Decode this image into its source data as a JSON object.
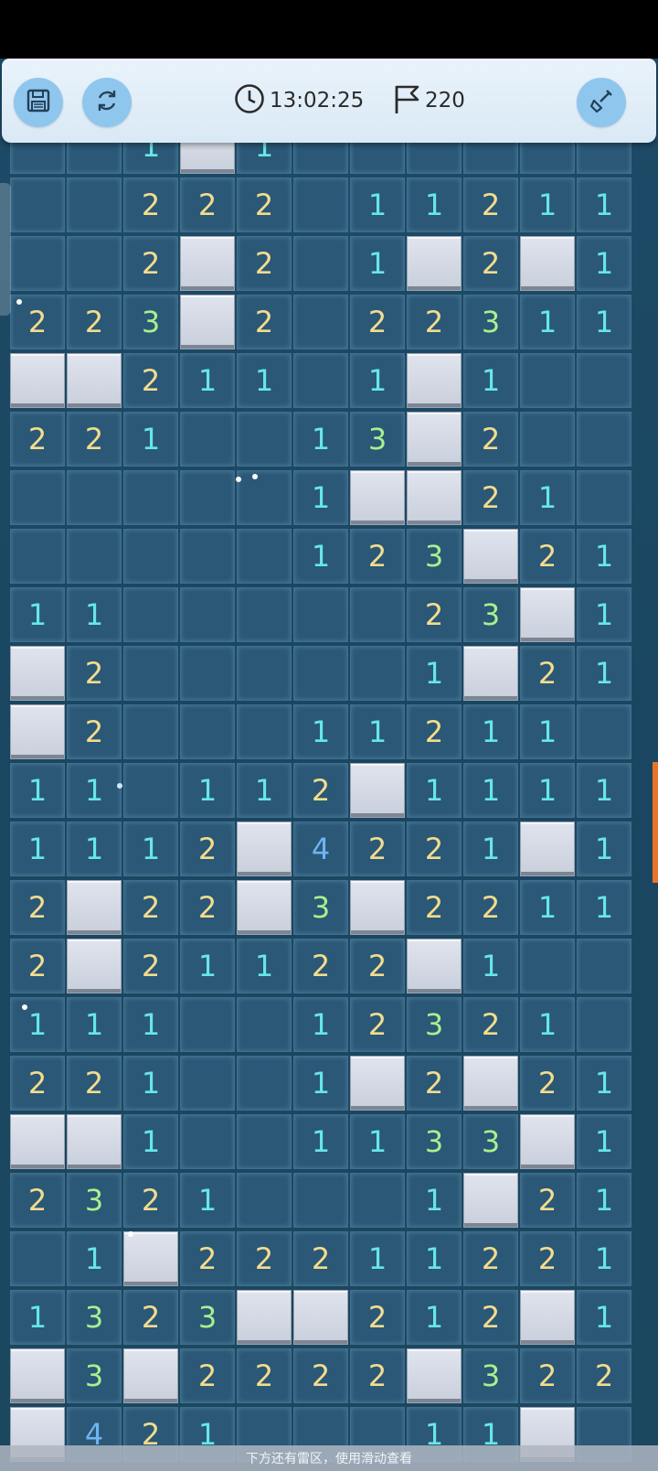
{
  "toolbar": {
    "timer": "13:02:25",
    "flags": "220",
    "icons": {
      "save": "save-icon",
      "restart": "restart-icon",
      "clock": "clock-icon",
      "flag": "flag-icon",
      "shovel": "shovel-icon"
    }
  },
  "hint": "下方还有雷区，使用滑动查看",
  "colors": {
    "1": "#66e7e7",
    "2": "#f3dc8e",
    "3": "#a8f08e",
    "4": "#6fb4f3",
    "scroll_indicator": "#e8732a"
  },
  "board": {
    "legend": "# = covered cell, . = revealed empty cell, digit = revealed number",
    "partial_top_row": [
      "",
      "",
      "1",
      "#",
      "1",
      "",
      "",
      "",
      "",
      "",
      ""
    ],
    "rows": [
      "..222.11211",
      "..2#2.1#2#1",
      "223#2.22311",
      "##211.1#1..",
      "221..13#2..",
      ".....1##21.",
      ".....123#21",
      "11.....23#1",
      "#2.....1#21",
      "#2...11211.",
      "11.112#1111",
      "1112#4221#1",
      "2#22#3#2211",
      "2#21122#1..",
      "111..12321.",
      "221..1#2#21",
      "##1..1133#1",
      "232 1...1#21",
      ".1#2221122 1",
      "13 23##212#1",
      "#3#2222#322"
    ],
    "partial_bottom_row": [
      "#",
      "4",
      "2",
      "1",
      "",
      "",
      "",
      "1",
      "1",
      "#",
      ""
    ]
  }
}
